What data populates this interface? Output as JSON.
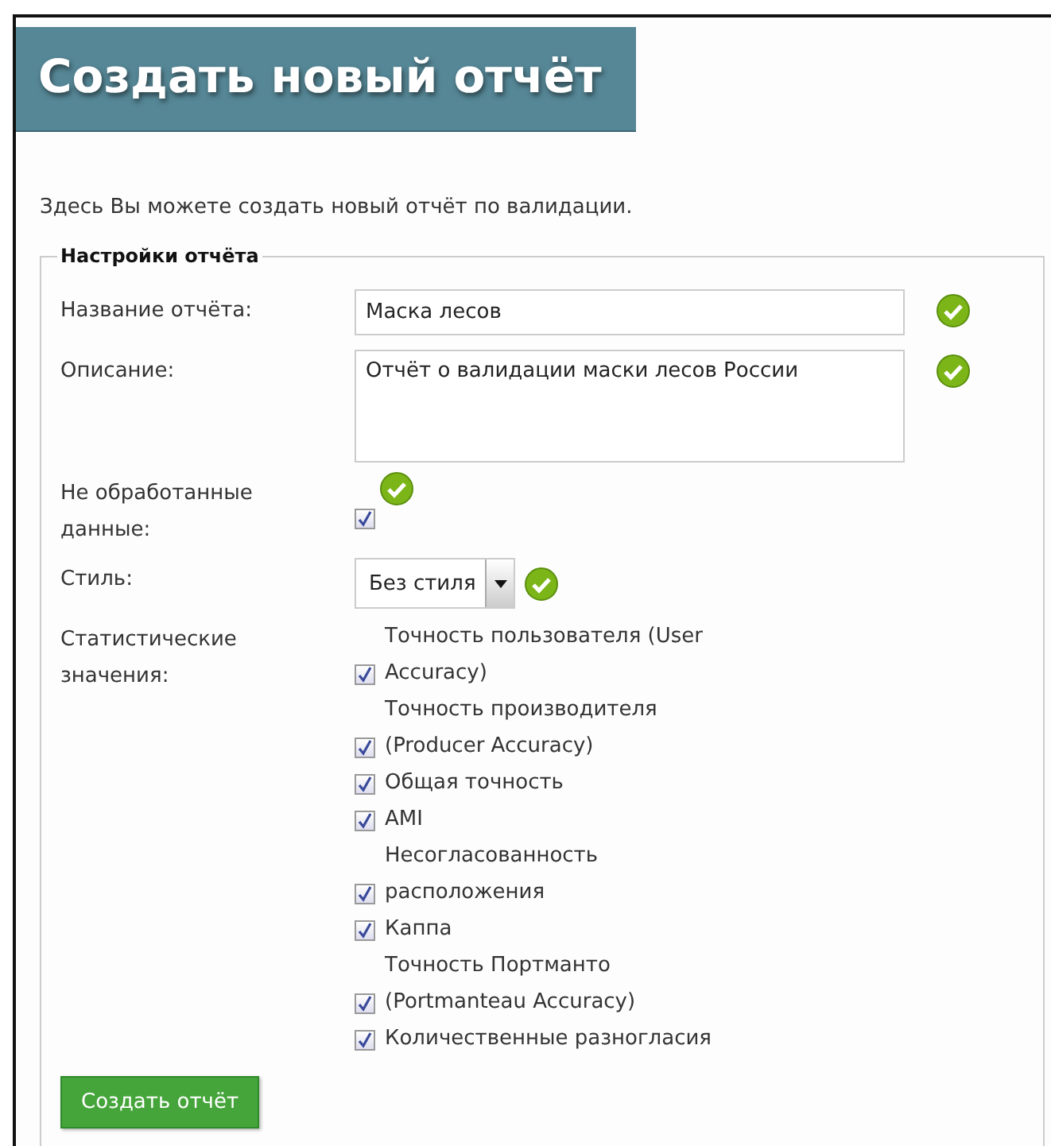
{
  "page": {
    "title": "Создать новый отчёт",
    "intro": "Здесь Вы можете создать новый отчёт по валидации."
  },
  "settings": {
    "legend": "Настройки отчёта",
    "fields": [
      {
        "kind": "text",
        "label": "Название отчёта:",
        "value": "Маска лесов",
        "valid": true
      },
      {
        "kind": "textarea",
        "label": "Описание:",
        "value": "Отчёт о валидации маски лесов России",
        "valid": true
      },
      {
        "kind": "checkbox",
        "label": "Не обработанные данные:",
        "checked": true,
        "valid": true
      },
      {
        "kind": "select",
        "label": "Стиль:",
        "value": "Без стиля",
        "valid": true
      },
      {
        "kind": "checklist",
        "label": "Статистические значения:",
        "valid": false,
        "options": [
          {
            "label": "Точность пользователя (User Accuracy)",
            "checked": true
          },
          {
            "label": "Точность производителя (Producer Accuracy)",
            "checked": true
          },
          {
            "label": "Общая точность",
            "checked": true
          },
          {
            "label": "AMI",
            "checked": true
          },
          {
            "label": "Несогласованность расположения",
            "checked": true
          },
          {
            "label": "Каппа",
            "checked": true
          },
          {
            "label": "Точность Портманто (Portmanteau Accuracy)",
            "checked": true
          },
          {
            "label": "Количественные разногласия",
            "checked": true
          }
        ]
      }
    ],
    "submit": "Создать отчёт"
  }
}
